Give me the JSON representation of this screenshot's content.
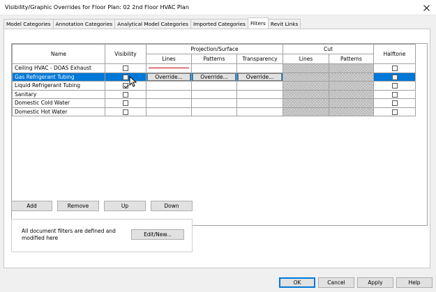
{
  "window": {
    "title": "Visibility/Graphic Overrides for Floor Plan: 02 2nd Floor HVAC Plan",
    "close_glyph": "✕"
  },
  "tabs": [
    {
      "label": "Model Categories",
      "active": false
    },
    {
      "label": "Annotation Categories",
      "active": false
    },
    {
      "label": "Analytical Model Categories",
      "active": false
    },
    {
      "label": "Imported Categories",
      "active": false
    },
    {
      "label": "Filters",
      "active": true
    },
    {
      "label": "Revit Links",
      "active": false
    }
  ],
  "grid": {
    "headers": {
      "name": "Name",
      "visibility": "Visibility",
      "projection_surface": "Projection/Surface",
      "cut": "Cut",
      "halftone": "Halftone",
      "lines": "Lines",
      "patterns": "Patterns",
      "transparency": "Transparency"
    },
    "override_label": "Override...",
    "rows": [
      {
        "name": "Ceiling HVAC - DOAS Exhaust",
        "visible": false,
        "halftone": false,
        "selected": false,
        "line_override_color": "#c00000"
      },
      {
        "name": "Gas Refrigerant Tubing",
        "visible": false,
        "halftone": false,
        "selected": true
      },
      {
        "name": "Liquid Refrigerant Tubing",
        "visible": true,
        "halftone": false,
        "selected": false
      },
      {
        "name": "Sanitary",
        "visible": false,
        "halftone": false,
        "selected": false
      },
      {
        "name": "Domestic Cold Water",
        "visible": false,
        "halftone": false,
        "selected": false
      },
      {
        "name": "Domestic Hot Water",
        "visible": false,
        "halftone": false,
        "selected": false
      }
    ]
  },
  "row_buttons": {
    "add": "Add",
    "remove": "Remove",
    "up": "Up",
    "down": "Down"
  },
  "info": {
    "text": "All document filters are defined and modified here",
    "edit_new": "Edit/New..."
  },
  "footer": {
    "ok": "OK",
    "cancel": "Cancel",
    "apply": "Apply",
    "help": "Help"
  },
  "colors": {
    "selection": "#0078d7",
    "override_line": "#c00000"
  }
}
